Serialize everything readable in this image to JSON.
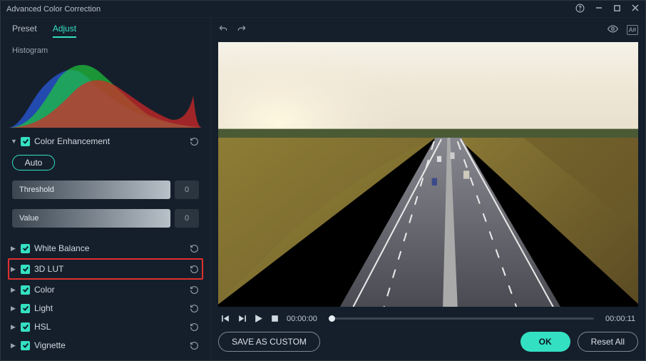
{
  "window": {
    "title": "Advanced Color Correction"
  },
  "sidebar": {
    "tabs": {
      "preset": "Preset",
      "adjust": "Adjust"
    },
    "histogram_label": "Histogram",
    "enhancement": {
      "label": "Color Enhancement"
    },
    "auto_label": "Auto",
    "threshold": {
      "label": "Threshold",
      "value": "0"
    },
    "value_row": {
      "label": "Value",
      "value": "0"
    },
    "sections": {
      "white_balance": "White Balance",
      "lut": "3D LUT",
      "color": "Color",
      "light": "Light",
      "hsl": "HSL",
      "vignette": "Vignette"
    }
  },
  "transport": {
    "current": "00:00:00",
    "total": "00:00:11"
  },
  "footer": {
    "save_custom": "SAVE AS CUSTOM",
    "ok": "OK",
    "reset_all": "Reset All"
  }
}
